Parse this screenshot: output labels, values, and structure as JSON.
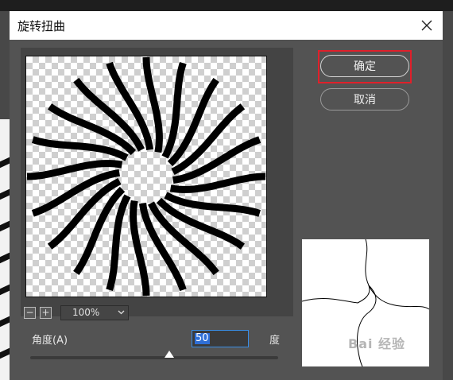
{
  "dialog": {
    "title": "旋转扭曲",
    "ok_label": "确定",
    "cancel_label": "取消"
  },
  "preview": {
    "zoom_value": "100%",
    "zoom_out_label": "−",
    "zoom_in_label": "+"
  },
  "angle": {
    "label": "角度(A)",
    "value": "50",
    "unit": "度",
    "slider_fraction": 0.56
  },
  "watermark": {
    "text": "Bai 经验"
  },
  "colors": {
    "accent": "#2f6fd6",
    "highlight_box": "#e0202a",
    "dialog_bg": "#535353"
  }
}
